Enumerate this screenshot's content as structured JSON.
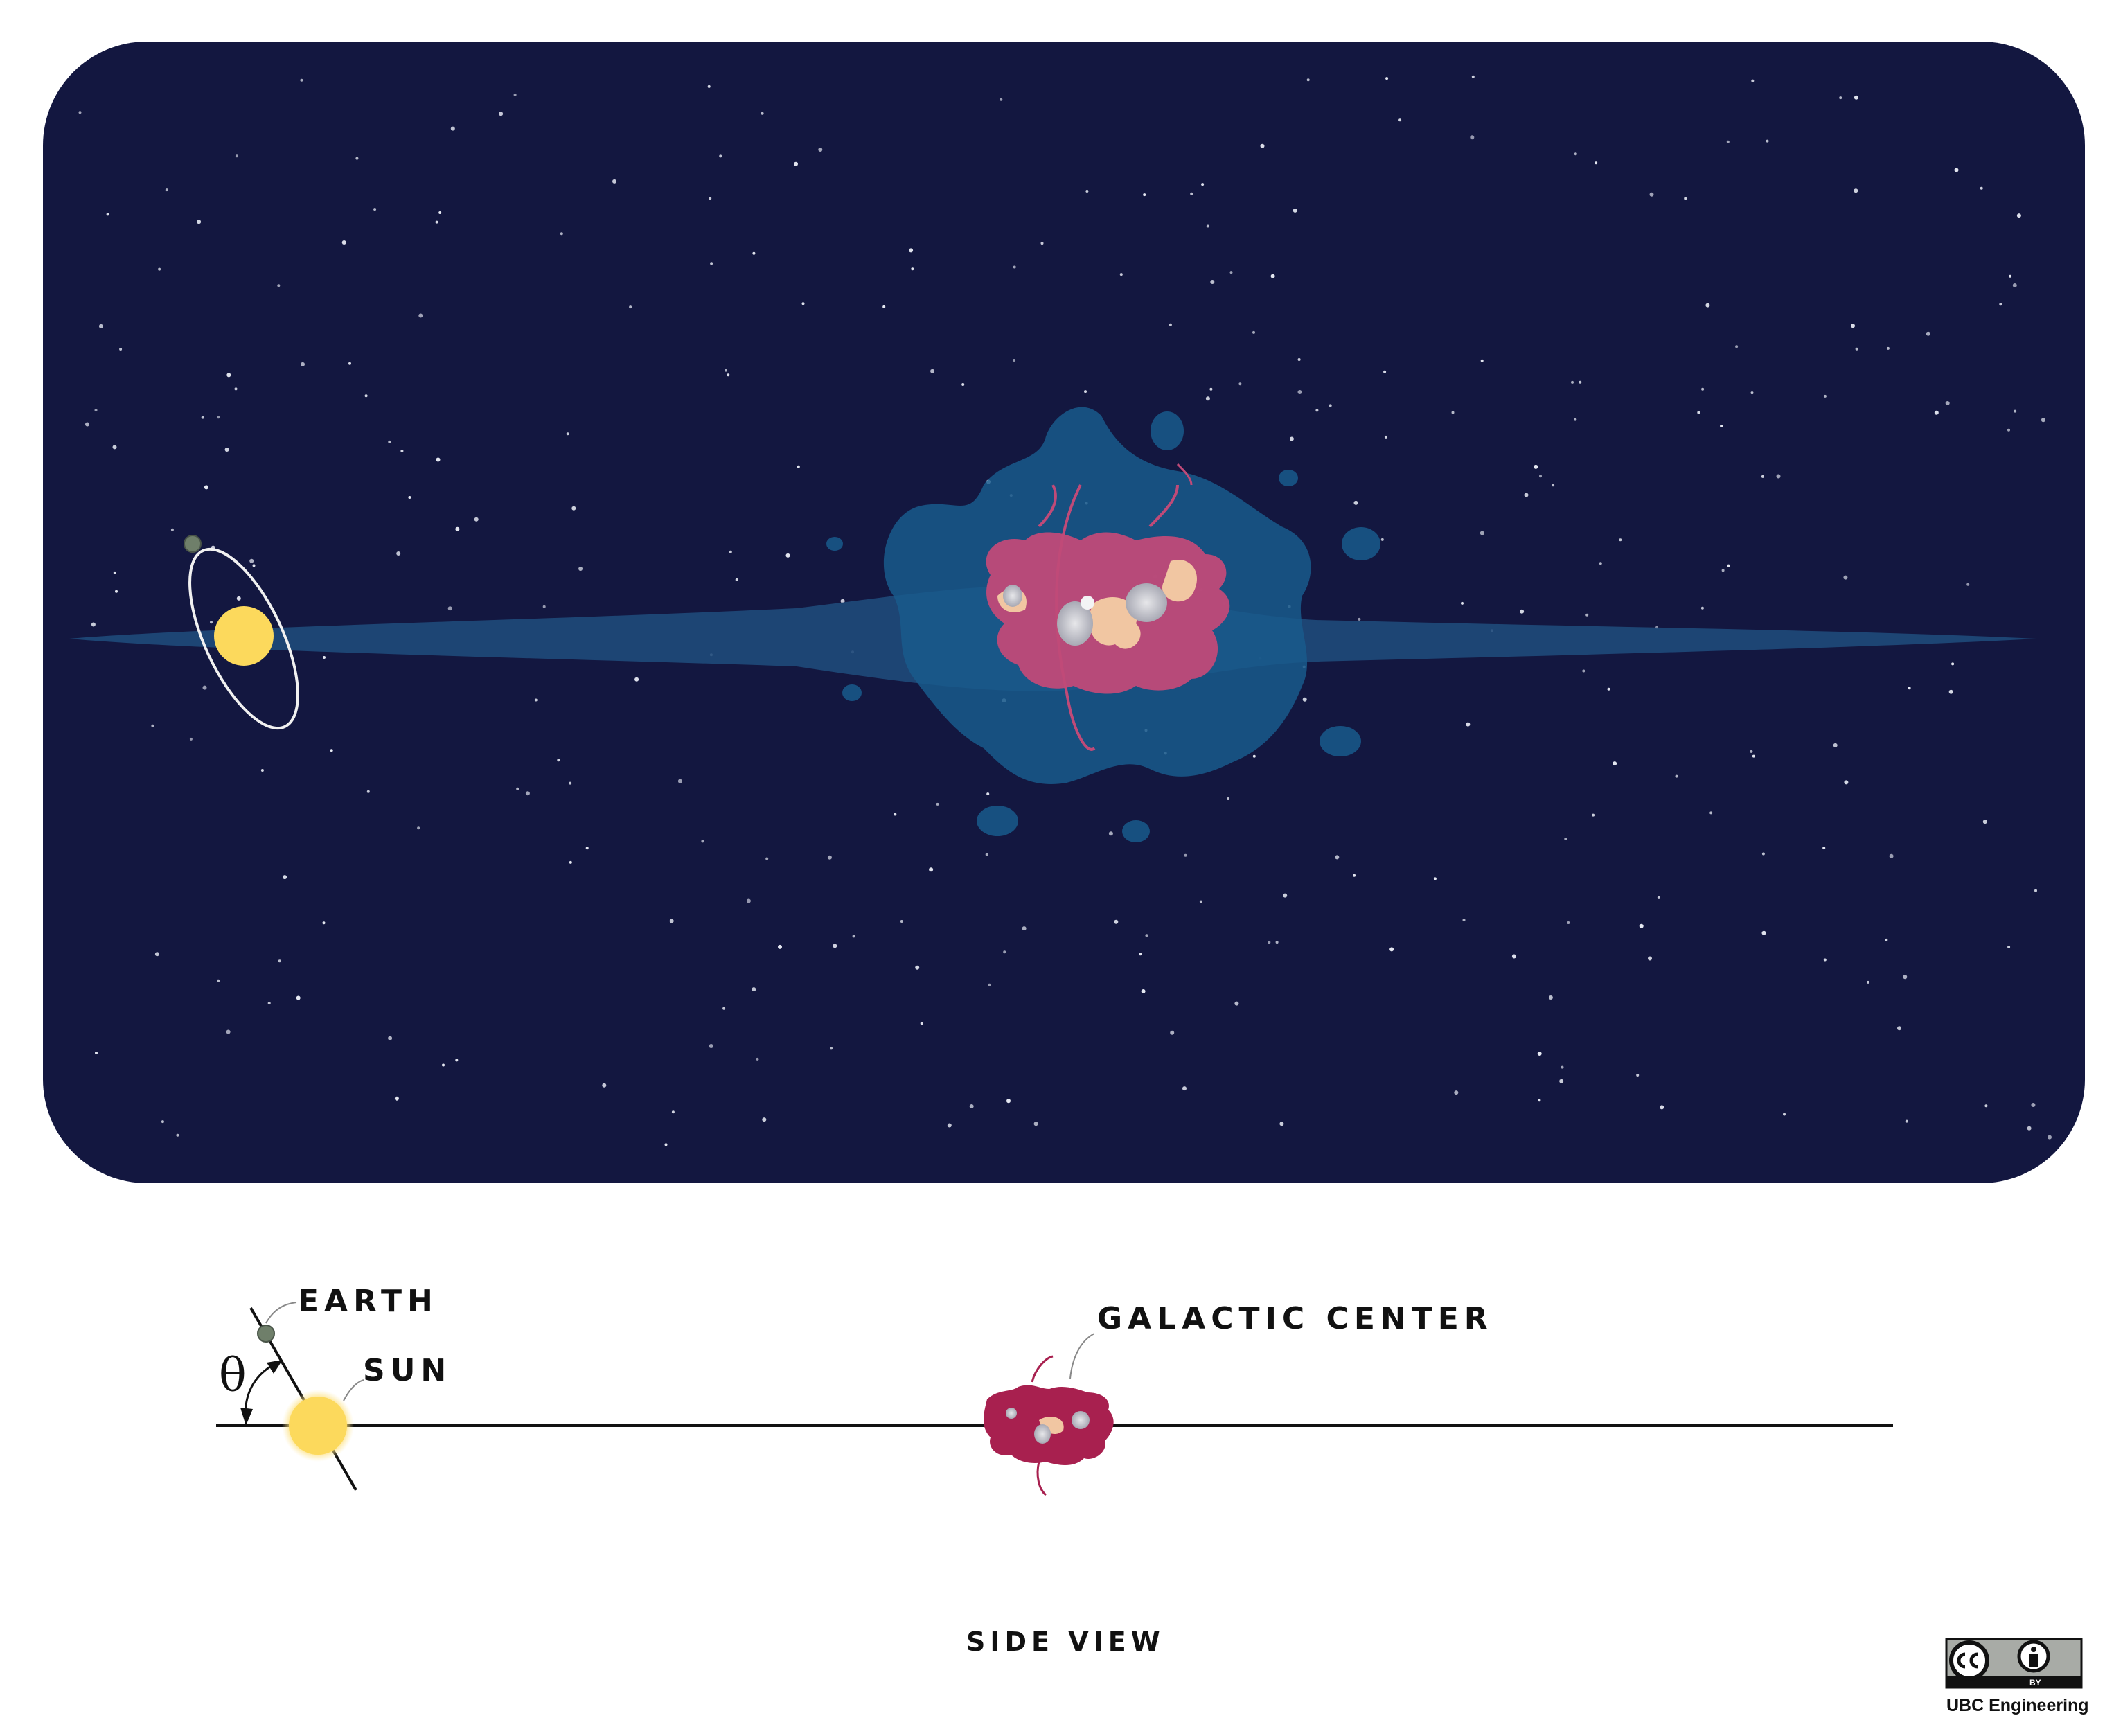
{
  "labels": {
    "earth": "EARTH",
    "sun": "SUN",
    "theta": "θ",
    "galactic_center": "GALACTIC CENTER",
    "side_view": "SIDE VIEW"
  },
  "license": {
    "badge_text": "BY",
    "credit": "UBC Engineering"
  },
  "colors": {
    "space": "#131740",
    "galaxy_disk": "#1f4a7a",
    "bulge": "#195a8c",
    "core": "#c04a78",
    "sun": "#fcd95c",
    "earth": "#6f7f6a"
  },
  "icons": [
    "sun-icon",
    "earth-icon",
    "galactic-center-icon",
    "cc-icon",
    "by-person-icon"
  ]
}
